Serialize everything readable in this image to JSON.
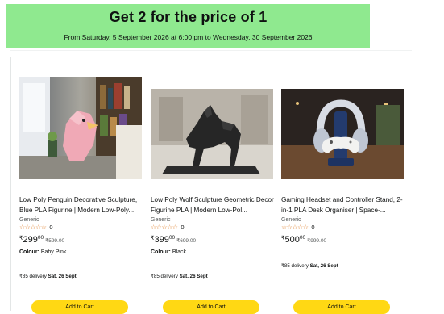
{
  "banner": {
    "title": "Get 2 for the price of 1",
    "subtitle": "From Saturday, 5 September 2026 at 6:00 pm to Wednesday, 30 September 2026"
  },
  "products": [
    {
      "title": "Low Poly Penguin Decorative Sculpture, Blue PLA Figurine | Modern Low-Poly...",
      "brand": "Generic",
      "stars": "☆☆☆☆☆",
      "rating_count": "0",
      "currency": "₹",
      "price_whole": "299",
      "price_fraction": "00",
      "mrp": "₹599.00",
      "colour_label": "Colour:",
      "colour_value": "Baby Pink",
      "delivery_prefix": "₹85 delivery",
      "delivery_date": "Sat, 26 Sept",
      "button": "Add to Cart",
      "image": "pink-penguin-figurine"
    },
    {
      "title": "Low Poly Wolf Sculpture Geometric Decor Figurine PLA | Modern Low-Pol...",
      "brand": "Generic",
      "stars": "☆☆☆☆☆",
      "rating_count": "0",
      "currency": "₹",
      "price_whole": "399",
      "price_fraction": "00",
      "mrp": "₹699.00",
      "colour_label": "Colour:",
      "colour_value": "Black",
      "delivery_prefix": "₹85 delivery",
      "delivery_date": "Sat, 26 Sept",
      "button": "Add to Cart",
      "image": "black-wolf-sculpture"
    },
    {
      "title": "Gaming Headset and Controller Stand, 2-in-1 PLA Desk Organiser | Space-...",
      "brand": "Generic",
      "stars": "☆☆☆☆☆",
      "rating_count": "0",
      "currency": "₹",
      "price_whole": "500",
      "price_fraction": "00",
      "mrp": "₹999.00",
      "colour_label": "",
      "colour_value": "",
      "delivery_prefix": "₹85 delivery",
      "delivery_date": "Sat, 26 Sept",
      "button": "Add to Cart",
      "image": "headset-controller-stand"
    }
  ],
  "colors": {
    "banner": "#8fe98f",
    "button": "#ffd814",
    "star": "#de7921"
  }
}
